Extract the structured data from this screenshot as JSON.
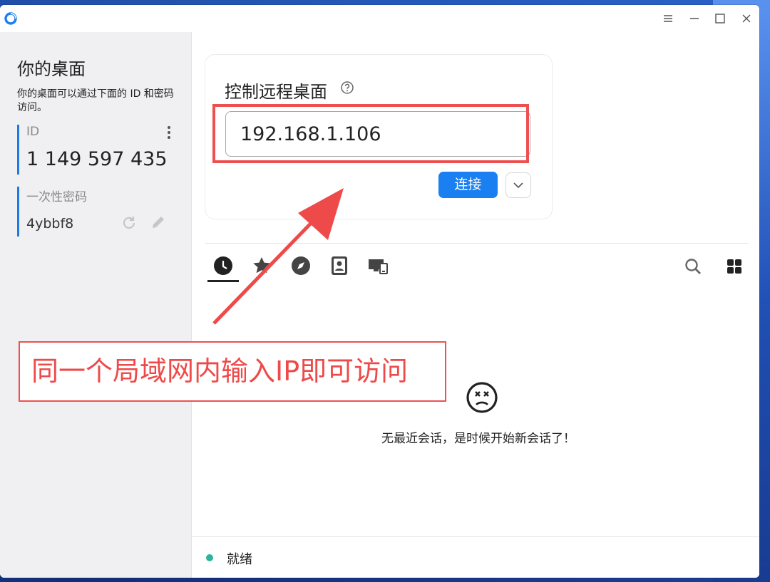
{
  "app": {
    "accent": "#1a7ff0"
  },
  "window_controls": [
    "menu-icon",
    "minimize-icon",
    "maximize-icon",
    "close-icon"
  ],
  "sidebar": {
    "title": "你的桌面",
    "description": "你的桌面可以通过下面的 ID 和密码访问。",
    "id_label": "ID",
    "id_value": "1 149 597 435",
    "password_label": "一次性密码",
    "password_value": "4ybbf8"
  },
  "connect_card": {
    "title": "控制远程桌面",
    "input_value": "192.168.1.106",
    "connect_label": "连接"
  },
  "tabs": [
    {
      "name": "recent-sessions",
      "icon": "clock-icon",
      "active": true
    },
    {
      "name": "favorites",
      "icon": "star-icon"
    },
    {
      "name": "discovered",
      "icon": "compass-icon"
    },
    {
      "name": "address-book",
      "icon": "contact-book-icon"
    },
    {
      "name": "group",
      "icon": "devices-icon"
    }
  ],
  "tools": [
    "search-icon",
    "grid-view-icon"
  ],
  "empty_state": {
    "message": "无最近会话，是时候开始新会话了！"
  },
  "status": {
    "text": "就绪",
    "color": "#2cb59a"
  },
  "annotation": {
    "note": "同一个局域网内输入IP即可访问",
    "color": "#ee5050"
  }
}
